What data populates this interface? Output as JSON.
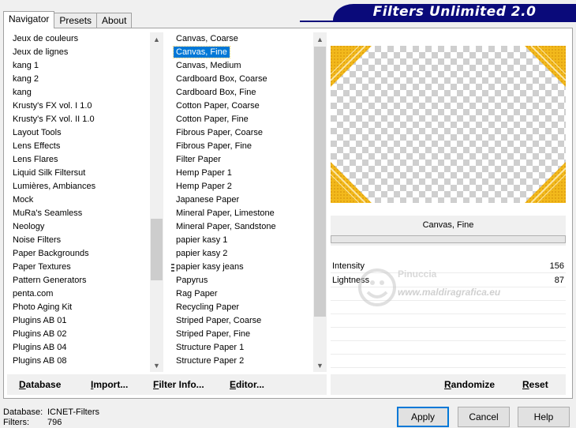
{
  "header": {
    "title": "Filters Unlimited 2.0"
  },
  "tabs": [
    {
      "label": "Navigator",
      "active": true
    },
    {
      "label": "Presets",
      "active": false
    },
    {
      "label": "About",
      "active": false
    }
  ],
  "categories": [
    "Jeux de couleurs",
    "Jeux de lignes",
    "kang 1",
    "kang 2",
    "kang",
    "Krusty's FX vol. I 1.0",
    "Krusty's FX vol. II 1.0",
    "Layout Tools",
    "Lens Effects",
    "Lens Flares",
    "Liquid Silk Filtersut",
    "Lumières, Ambiances",
    "Mock",
    "MuRa's Seamless",
    "Neology",
    "Noise Filters",
    "Paper Backgrounds",
    "Paper Textures",
    "Pattern Generators",
    "penta.com",
    "Photo Aging Kit",
    "Plugins AB 01",
    "Plugins AB 02",
    "Plugins AB 04",
    "Plugins AB 08"
  ],
  "filters": [
    "Canvas, Coarse",
    "Canvas, Fine",
    "Canvas, Medium",
    "Cardboard Box, Coarse",
    "Cardboard Box, Fine",
    "Cotton Paper, Coarse",
    "Cotton Paper, Fine",
    "Fibrous Paper, Coarse",
    "Fibrous Paper, Fine",
    "Filter Paper",
    "Hemp Paper 1",
    "Hemp Paper 2",
    "Japanese Paper",
    "Mineral Paper, Limestone",
    "Mineral Paper, Sandstone",
    "papier kasy 1",
    "papier kasy 2",
    "papier kasy jeans",
    "Papyrus",
    "Rag Paper",
    "Recycling Paper",
    "Striped Paper, Coarse",
    "Striped Paper, Fine",
    "Structure Paper 1",
    "Structure Paper 2"
  ],
  "selected_filter_index": 1,
  "preview": {
    "filter_name": "Canvas, Fine",
    "frame_color": "#f2b91c"
  },
  "params": [
    {
      "name": "Intensity",
      "value": "156"
    },
    {
      "name": "Lightness",
      "value": "87"
    }
  ],
  "watermark": {
    "name": "Pinuccia",
    "url": "www.maldiragrafica.eu"
  },
  "toolbar": {
    "database": {
      "accel": "D",
      "rest": "atabase"
    },
    "import": {
      "accel": "I",
      "rest": "mport..."
    },
    "filter_info": {
      "accel": "F",
      "rest": "ilter Info..."
    },
    "editor": {
      "accel": "E",
      "rest": "ditor..."
    },
    "randomize": {
      "accel": "R",
      "rest": "andomize"
    },
    "reset": {
      "accel": "R",
      "rest": "eset"
    }
  },
  "footer": {
    "database_label": "Database:",
    "database_value": "ICNET-Filters",
    "filters_label": "Filters:",
    "filters_value": "796"
  },
  "buttons": {
    "apply": "Apply",
    "cancel": "Cancel",
    "help": "Help"
  }
}
